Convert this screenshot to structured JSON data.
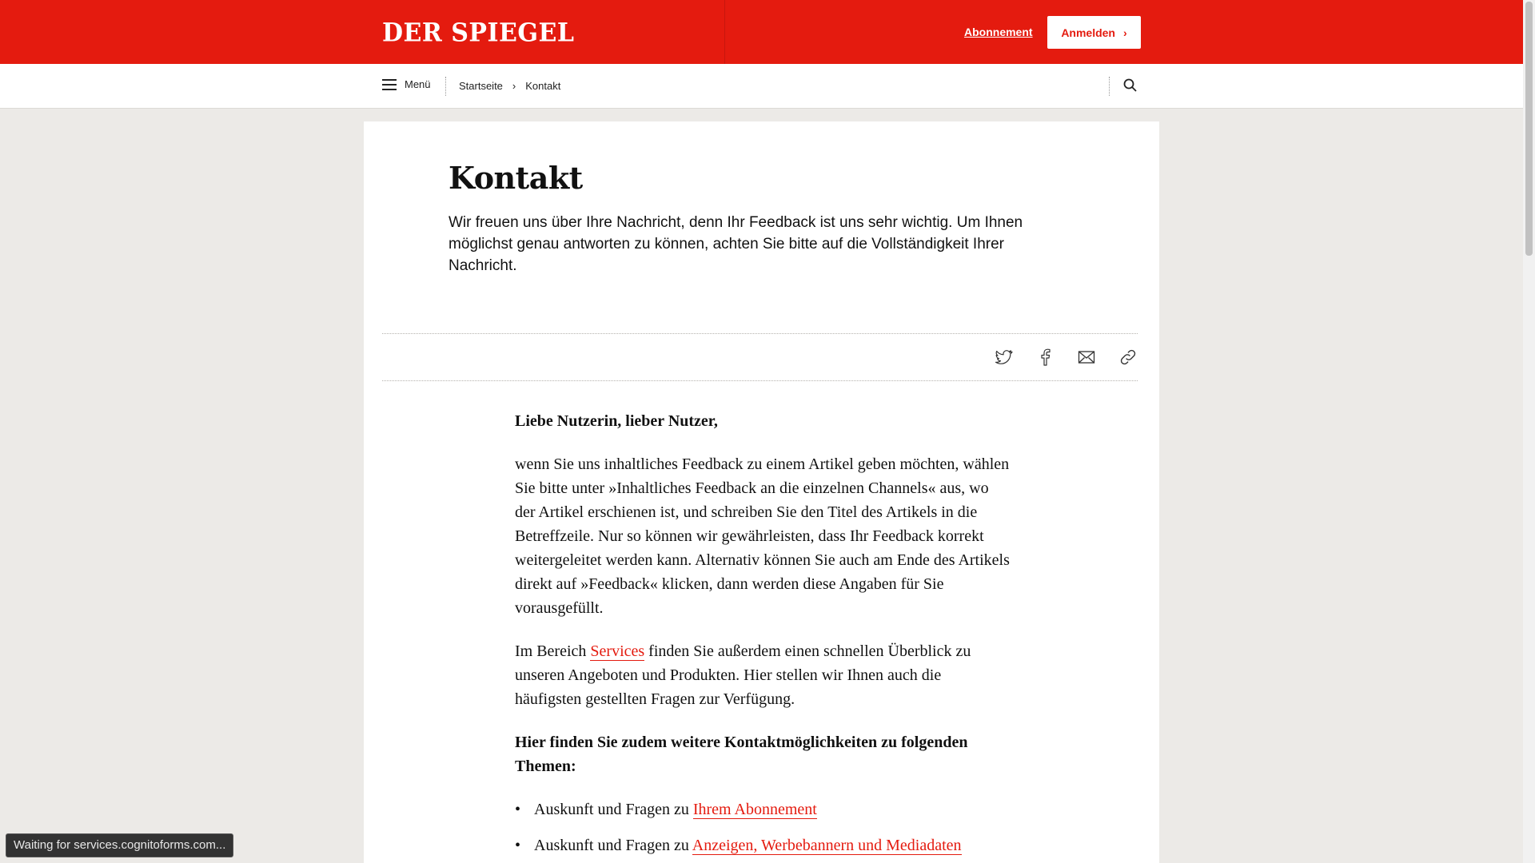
{
  "header": {
    "logo": "DER SPIEGEL",
    "abo_link": "Abonnement",
    "login_label": "Anmelden"
  },
  "nav": {
    "menu_label": "Menü",
    "breadcrumbs": [
      "Startseite",
      "Kontakt"
    ]
  },
  "article": {
    "title": "Kontakt",
    "intro": "Wir freuen uns über Ihre Nachricht, denn Ihr Feedback ist uns sehr wichtig. Um Ihnen möglichst genau antworten zu können, achten Sie bitte auf die Vollständigkeit Ihrer Nachricht.",
    "share_icons": [
      "twitter-icon",
      "facebook-icon",
      "mail-icon",
      "link-icon"
    ],
    "greeting": "Liebe Nutzerin, lieber Nutzer,",
    "paragraph1": "wenn Sie uns inhaltliches Feedback zu einem Artikel geben möchten, wählen Sie bitte unter »Inhaltliches Feedback an die einzelnen Channels« aus, wo der Artikel erschienen ist, und schreiben Sie den Titel des Artikels in die Betreffzeile. Nur so können wir gewährleisten, dass Ihr Feedback korrekt weitergeleitet werden kann. Alternativ können Sie auch am Ende des Artikels direkt auf »Feedback« klicken, dann werden diese Angaben für Sie vorausgefüllt.",
    "paragraph2_before": "Im Bereich ",
    "paragraph2_link": "Services",
    "paragraph2_after": " finden Sie außerdem einen schnellen Überblick zu unseren Angeboten und Produkten. Hier stellen wir Ihnen auch die häufigsten gestellten Fragen zur Verfügung.",
    "subheading": "Hier finden Sie zudem weitere Kontaktmöglichkeiten zu folgenden Themen:",
    "list": [
      {
        "prefix": "Auskunft und Fragen zu ",
        "link": "Ihrem Abonnement"
      },
      {
        "prefix": "Auskunft und Fragen zu ",
        "link": "Anzeigen, Werbebannern und Mediadaten"
      }
    ]
  },
  "status_bar": "Waiting for services.cognitoforms.com...",
  "colors": {
    "brand_red": "#e41b0f",
    "page_bg": "#eceae7"
  }
}
